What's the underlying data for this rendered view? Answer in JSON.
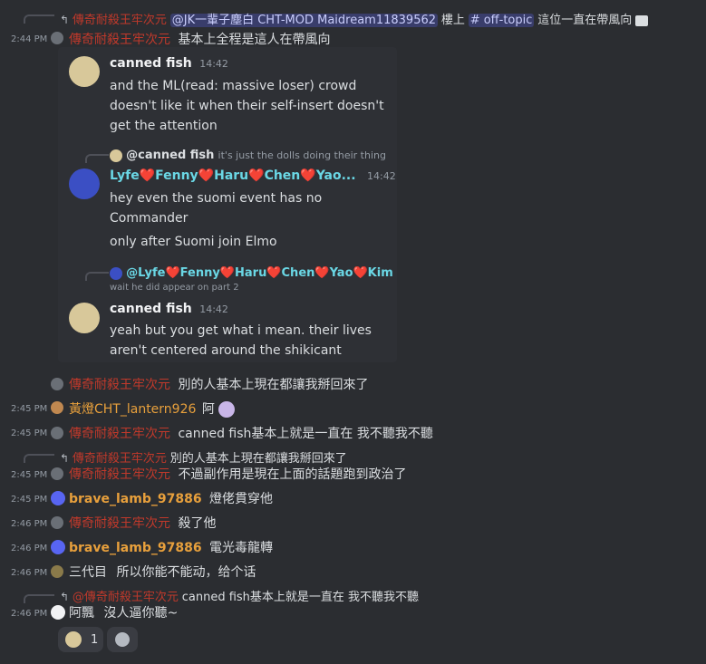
{
  "reply0": {
    "author": "傳奇耐殺王牢次元",
    "mention": "@JK一輩子塵白 CHT-MOD Maidream11839562",
    "text1": "樓上",
    "channel": "# off-topic",
    "text2": "這位一直在帶風向"
  },
  "msg1": {
    "time": "2:44 PM",
    "author": "傳奇耐殺王牢次元",
    "text": "基本上全程是這人在帶風向"
  },
  "embed": {
    "m1": {
      "author": "canned fish",
      "time": "14:42",
      "lines": [
        "and the ML(read: massive loser) crowd",
        "doesn't like it when their self-insert doesn't",
        "get the attention"
      ]
    },
    "reply_a": {
      "author": "@canned fish",
      "text": "it's just the dolls doing their thing"
    },
    "m2": {
      "author": "Lyfe❤️Fenny❤️Haru❤️Chen❤️Yao...",
      "time": "14:42",
      "lines": [
        "hey even the suomi event has no",
        "Commander"
      ],
      "extra": "only after Suomi join Elmo"
    },
    "reply_b": {
      "author": "@Lyfe❤️Fenny❤️Haru❤️Chen❤️Yao❤️Kim",
      "text": "wait he did appear on part 2"
    },
    "m3": {
      "author": "canned fish",
      "time": "14:42",
      "lines": [
        "yeah but you get what i mean. their lives",
        "aren't centered around the shikicant"
      ]
    }
  },
  "msg2": {
    "author": "傳奇耐殺王牢次元",
    "text": "別的人基本上現在都讓我掰回來了"
  },
  "msg3": {
    "time": "2:45 PM",
    "author": "黃燈CHT_lantern926",
    "text": "阿"
  },
  "msg4": {
    "time": "2:45 PM",
    "author": "傳奇耐殺王牢次元",
    "text": "canned fish基本上就是一直在 我不聽我不聽"
  },
  "reply5": {
    "author": "傳奇耐殺王牢次元",
    "text": "別的人基本上現在都讓我掰回來了"
  },
  "msg5": {
    "time": "2:45 PM",
    "author": "傳奇耐殺王牢次元",
    "text": "不過副作用是現在上面的話題跑到政治了"
  },
  "msg6": {
    "time": "2:45 PM",
    "author": "brave_lamb_97886",
    "text": "燈佬貫穿他"
  },
  "msg7": {
    "time": "2:46 PM",
    "author": "傳奇耐殺王牢次元",
    "text": "殺了他"
  },
  "msg8": {
    "time": "2:46 PM",
    "author": "brave_lamb_97886",
    "text": "電光毒龍轉"
  },
  "msg9": {
    "time": "2:46 PM",
    "author": "三代目",
    "text": "所以你能不能动，给个话"
  },
  "reply10": {
    "author": "@傳奇耐殺王牢次元",
    "text": "canned fish基本上就是一直在 我不聽我不聽"
  },
  "msg10": {
    "time": "2:46 PM",
    "author": "阿飄",
    "text": "沒人逼你聽~"
  },
  "reaction": {
    "count": "1"
  },
  "colors": {
    "bg": "#2b2d31",
    "embed_bg": "#2e3035",
    "red_name": "#c0392b",
    "orange_name": "#e8a03c",
    "cyan_name": "#6ad7e5"
  }
}
